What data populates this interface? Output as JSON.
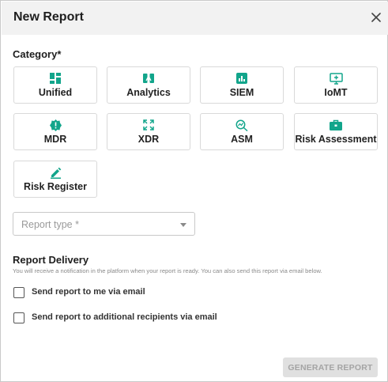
{
  "dialog": {
    "title": "New Report",
    "close_icon": "close-icon"
  },
  "category": {
    "label": "Category*",
    "items": [
      {
        "label": "Unified",
        "icon": "dashboard-icon"
      },
      {
        "label": "Analytics",
        "icon": "analytics-icon"
      },
      {
        "label": "SIEM",
        "icon": "bar-chart-icon"
      },
      {
        "label": "IoMT",
        "icon": "medical-monitor-icon"
      },
      {
        "label": "MDR",
        "icon": "alert-badge-icon"
      },
      {
        "label": "XDR",
        "icon": "expand-icon"
      },
      {
        "label": "ASM",
        "icon": "search-analytics-icon"
      },
      {
        "label": "Risk Assessment",
        "icon": "briefcase-icon"
      },
      {
        "label": "Risk Register",
        "icon": "pencil-icon"
      }
    ]
  },
  "report_type": {
    "placeholder": "Report type *"
  },
  "delivery": {
    "title": "Report Delivery",
    "description": "You will receive a notification in the platform when your report is ready. You can also send this report via email below.",
    "options": [
      {
        "label": "Send report to me via email",
        "checked": false
      },
      {
        "label": "Send report to additional recipients via email",
        "checked": false
      }
    ]
  },
  "actions": {
    "generate_label": "GENERATE REPORT",
    "generate_enabled": false
  },
  "colors": {
    "accent": "#12a58b",
    "disabled_bg": "#e0e0e0",
    "disabled_text": "#a4a4a4"
  }
}
